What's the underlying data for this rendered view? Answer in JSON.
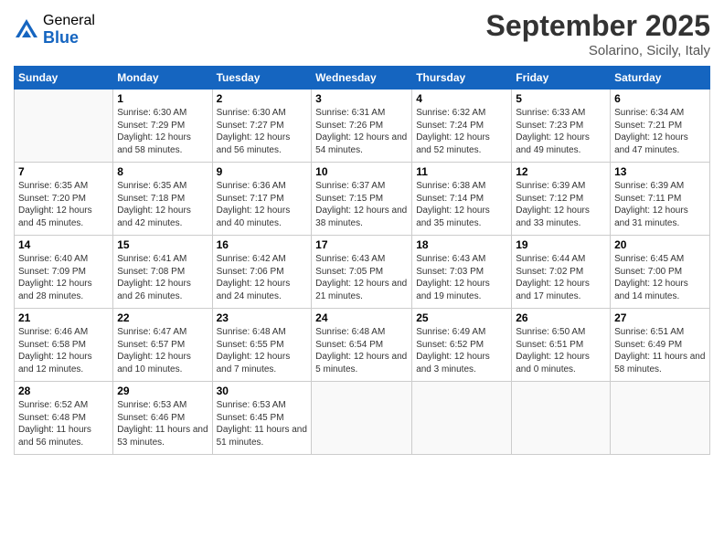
{
  "logo": {
    "general": "General",
    "blue": "Blue"
  },
  "title": "September 2025",
  "location": "Solarino, Sicily, Italy",
  "weekdays": [
    "Sunday",
    "Monday",
    "Tuesday",
    "Wednesday",
    "Thursday",
    "Friday",
    "Saturday"
  ],
  "weeks": [
    [
      {
        "day": "",
        "sunrise": "",
        "sunset": "",
        "daylight": ""
      },
      {
        "day": "1",
        "sunrise": "Sunrise: 6:30 AM",
        "sunset": "Sunset: 7:29 PM",
        "daylight": "Daylight: 12 hours and 58 minutes."
      },
      {
        "day": "2",
        "sunrise": "Sunrise: 6:30 AM",
        "sunset": "Sunset: 7:27 PM",
        "daylight": "Daylight: 12 hours and 56 minutes."
      },
      {
        "day": "3",
        "sunrise": "Sunrise: 6:31 AM",
        "sunset": "Sunset: 7:26 PM",
        "daylight": "Daylight: 12 hours and 54 minutes."
      },
      {
        "day": "4",
        "sunrise": "Sunrise: 6:32 AM",
        "sunset": "Sunset: 7:24 PM",
        "daylight": "Daylight: 12 hours and 52 minutes."
      },
      {
        "day": "5",
        "sunrise": "Sunrise: 6:33 AM",
        "sunset": "Sunset: 7:23 PM",
        "daylight": "Daylight: 12 hours and 49 minutes."
      },
      {
        "day": "6",
        "sunrise": "Sunrise: 6:34 AM",
        "sunset": "Sunset: 7:21 PM",
        "daylight": "Daylight: 12 hours and 47 minutes."
      }
    ],
    [
      {
        "day": "7",
        "sunrise": "Sunrise: 6:35 AM",
        "sunset": "Sunset: 7:20 PM",
        "daylight": "Daylight: 12 hours and 45 minutes."
      },
      {
        "day": "8",
        "sunrise": "Sunrise: 6:35 AM",
        "sunset": "Sunset: 7:18 PM",
        "daylight": "Daylight: 12 hours and 42 minutes."
      },
      {
        "day": "9",
        "sunrise": "Sunrise: 6:36 AM",
        "sunset": "Sunset: 7:17 PM",
        "daylight": "Daylight: 12 hours and 40 minutes."
      },
      {
        "day": "10",
        "sunrise": "Sunrise: 6:37 AM",
        "sunset": "Sunset: 7:15 PM",
        "daylight": "Daylight: 12 hours and 38 minutes."
      },
      {
        "day": "11",
        "sunrise": "Sunrise: 6:38 AM",
        "sunset": "Sunset: 7:14 PM",
        "daylight": "Daylight: 12 hours and 35 minutes."
      },
      {
        "day": "12",
        "sunrise": "Sunrise: 6:39 AM",
        "sunset": "Sunset: 7:12 PM",
        "daylight": "Daylight: 12 hours and 33 minutes."
      },
      {
        "day": "13",
        "sunrise": "Sunrise: 6:39 AM",
        "sunset": "Sunset: 7:11 PM",
        "daylight": "Daylight: 12 hours and 31 minutes."
      }
    ],
    [
      {
        "day": "14",
        "sunrise": "Sunrise: 6:40 AM",
        "sunset": "Sunset: 7:09 PM",
        "daylight": "Daylight: 12 hours and 28 minutes."
      },
      {
        "day": "15",
        "sunrise": "Sunrise: 6:41 AM",
        "sunset": "Sunset: 7:08 PM",
        "daylight": "Daylight: 12 hours and 26 minutes."
      },
      {
        "day": "16",
        "sunrise": "Sunrise: 6:42 AM",
        "sunset": "Sunset: 7:06 PM",
        "daylight": "Daylight: 12 hours and 24 minutes."
      },
      {
        "day": "17",
        "sunrise": "Sunrise: 6:43 AM",
        "sunset": "Sunset: 7:05 PM",
        "daylight": "Daylight: 12 hours and 21 minutes."
      },
      {
        "day": "18",
        "sunrise": "Sunrise: 6:43 AM",
        "sunset": "Sunset: 7:03 PM",
        "daylight": "Daylight: 12 hours and 19 minutes."
      },
      {
        "day": "19",
        "sunrise": "Sunrise: 6:44 AM",
        "sunset": "Sunset: 7:02 PM",
        "daylight": "Daylight: 12 hours and 17 minutes."
      },
      {
        "day": "20",
        "sunrise": "Sunrise: 6:45 AM",
        "sunset": "Sunset: 7:00 PM",
        "daylight": "Daylight: 12 hours and 14 minutes."
      }
    ],
    [
      {
        "day": "21",
        "sunrise": "Sunrise: 6:46 AM",
        "sunset": "Sunset: 6:58 PM",
        "daylight": "Daylight: 12 hours and 12 minutes."
      },
      {
        "day": "22",
        "sunrise": "Sunrise: 6:47 AM",
        "sunset": "Sunset: 6:57 PM",
        "daylight": "Daylight: 12 hours and 10 minutes."
      },
      {
        "day": "23",
        "sunrise": "Sunrise: 6:48 AM",
        "sunset": "Sunset: 6:55 PM",
        "daylight": "Daylight: 12 hours and 7 minutes."
      },
      {
        "day": "24",
        "sunrise": "Sunrise: 6:48 AM",
        "sunset": "Sunset: 6:54 PM",
        "daylight": "Daylight: 12 hours and 5 minutes."
      },
      {
        "day": "25",
        "sunrise": "Sunrise: 6:49 AM",
        "sunset": "Sunset: 6:52 PM",
        "daylight": "Daylight: 12 hours and 3 minutes."
      },
      {
        "day": "26",
        "sunrise": "Sunrise: 6:50 AM",
        "sunset": "Sunset: 6:51 PM",
        "daylight": "Daylight: 12 hours and 0 minutes."
      },
      {
        "day": "27",
        "sunrise": "Sunrise: 6:51 AM",
        "sunset": "Sunset: 6:49 PM",
        "daylight": "Daylight: 11 hours and 58 minutes."
      }
    ],
    [
      {
        "day": "28",
        "sunrise": "Sunrise: 6:52 AM",
        "sunset": "Sunset: 6:48 PM",
        "daylight": "Daylight: 11 hours and 56 minutes."
      },
      {
        "day": "29",
        "sunrise": "Sunrise: 6:53 AM",
        "sunset": "Sunset: 6:46 PM",
        "daylight": "Daylight: 11 hours and 53 minutes."
      },
      {
        "day": "30",
        "sunrise": "Sunrise: 6:53 AM",
        "sunset": "Sunset: 6:45 PM",
        "daylight": "Daylight: 11 hours and 51 minutes."
      },
      {
        "day": "",
        "sunrise": "",
        "sunset": "",
        "daylight": ""
      },
      {
        "day": "",
        "sunrise": "",
        "sunset": "",
        "daylight": ""
      },
      {
        "day": "",
        "sunrise": "",
        "sunset": "",
        "daylight": ""
      },
      {
        "day": "",
        "sunrise": "",
        "sunset": "",
        "daylight": ""
      }
    ]
  ]
}
